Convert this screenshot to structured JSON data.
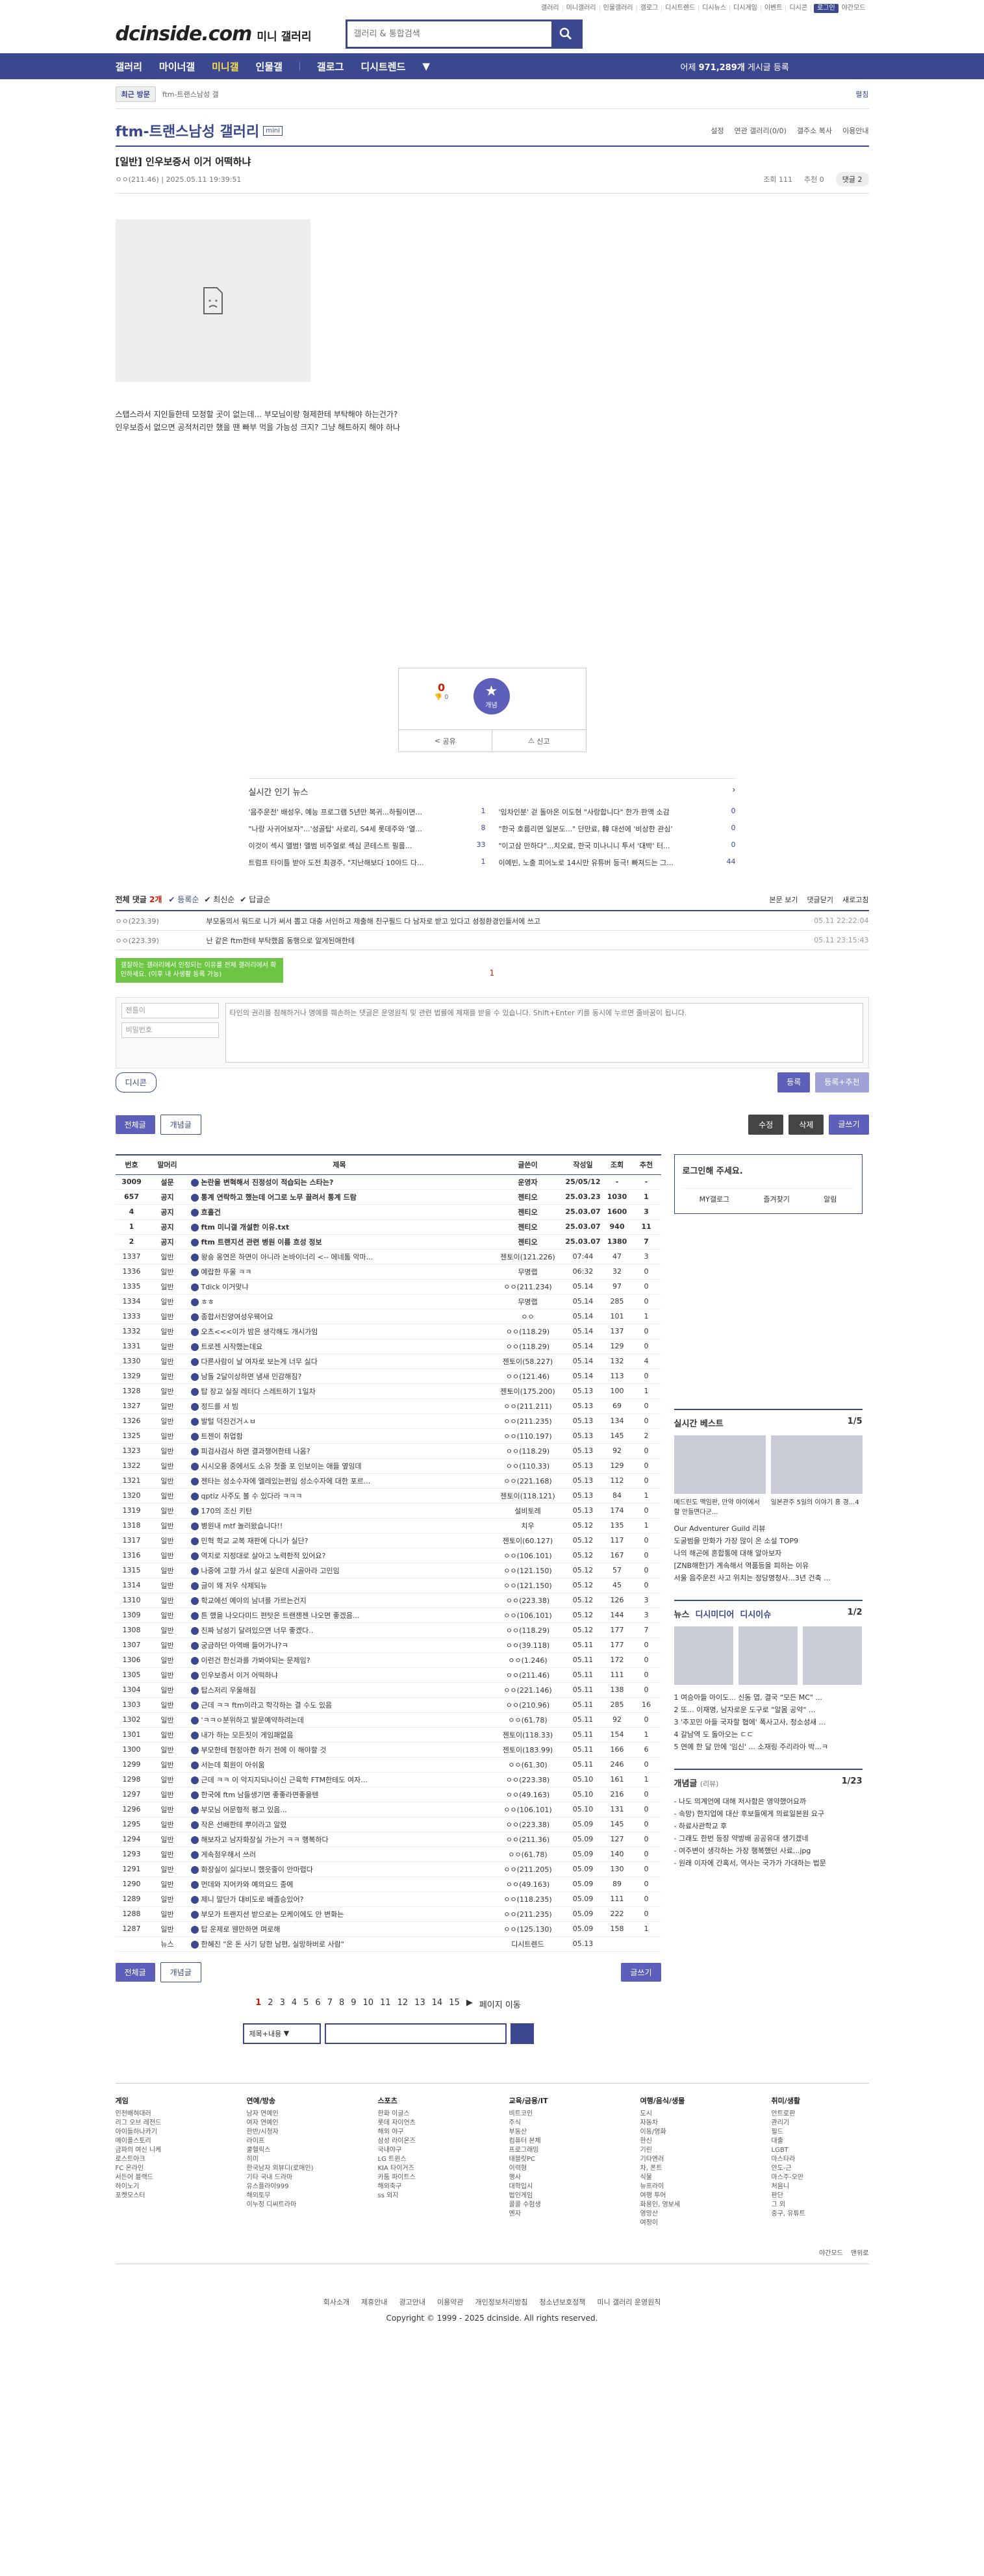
{
  "top": {
    "links": [
      "갤러리",
      "미니갤러리",
      "인물갤러리",
      "갤로그",
      "디시트렌드",
      "디시뉴스",
      "디시게임",
      "이벤트",
      "디시콘",
      "로그인",
      "야간모드"
    ]
  },
  "header": {
    "logo": "dcinside.com",
    "logo_sub": "미니 갤러리",
    "search_placeholder": "갤러리 & 통합검색"
  },
  "nav": {
    "items": [
      "갤러리",
      "마이너갤",
      "미니갤",
      "인물갤",
      "갤로그",
      "디시트렌드"
    ],
    "right_prefix": "어제",
    "right_count": "971,289개",
    "right_suffix": "게시글 등록"
  },
  "subbar": {
    "visit": "최근 방문",
    "crumb": "ftm-트랜스남성 갤",
    "expand": "펼침"
  },
  "gallery": {
    "title": "ftm-트랜스남성 갤러리",
    "mini": "mini",
    "opts": [
      "설정",
      "연관 갤러리(0/0)",
      "갤주소 복사",
      "이용안내"
    ]
  },
  "post": {
    "title": "[일반] 인우보증서 이거 어떡하냐",
    "writer": "ㅇㅇ(211.46)",
    "date": "2025.05.11 19:39:51",
    "views": "조회 111",
    "recommend": "추천 0",
    "comments": "댓글 2",
    "body": [
      "스탭스라서 지인들한테 모정할 곳이 없는데... 부모님이랑 형제한테 부탁해야 하는건가?",
      "인우보증서 없으면 공적처리만 했을 땐 빠부 먹을 가능성 크지? 그냥 해트하지 해야 하나"
    ],
    "up": "0",
    "down_label": "0",
    "star_label": "개념",
    "share": "공유",
    "report": "신고"
  },
  "news": {
    "title": "실시간 인기 뉴스",
    "items": [
      [
        "'음주운전' 배성우, 예능 프로그램 5년만 복귀...하필이면...",
        "1"
      ],
      [
        "'임차인분' 걷 돌아온 이도현 \"사랑합니다\" 한가 판액 소감",
        "0"
      ],
      [
        "\"나랑 사귀어보자\"...'성골탑' 사로리, S4세 롯데주와 '열...",
        "8"
      ],
      [
        "\"한국 호름리면 일본도...\" 단만료, 韓 대선에 '비상한 관심'",
        "0"
      ],
      [
        "이것이 섹시 앨범! 앨범 비주얼로 섹심 콘테스트 필름...",
        "33"
      ],
      [
        "\"이고삼 만하다\"...치오료, 한국 미나니니 투서 '대박' 터...",
        "0"
      ],
      [
        "트럼프 타이틀 받아 도전 최경주, \"지난해보다 10야드 다...",
        "1"
      ],
      [
        "이예빈, 노출 피어노로 14시만 유튜버 등극! 빠져드는 그...",
        "44"
      ]
    ]
  },
  "comments": {
    "title": "전체 댓글",
    "count": "2개",
    "sort": [
      "등록순",
      "최신순",
      "답글순"
    ],
    "opts": [
      "본문 보기",
      "댓글닫기",
      "새로고침"
    ],
    "items": [
      [
        "ㅇㅇ(223.39)",
        "부모동의서 워드로 니가 써서 뽑고 대충 서인하고 제출해 친구필드 다 남자로 받고 있다고 성정환경인들서에 쓰고",
        "05.11 22:22:04"
      ],
      [
        "ㅇㅇ(223.39)",
        "난 같은 ftm한테 부탁했음 동행으로 알게된애한테",
        "05.11 23:15:43"
      ]
    ],
    "tip": "갤질하는 갤러리에서 인정되는 이유를 전체 갤러리에서 확인하세요. (이후 내 사생활 등록 가능)",
    "page": "1",
    "nick_placeholder": "젠틀이",
    "pw_placeholder": "비밀번호",
    "text_placeholder": "타인의 권리를 침해하거나 명예를 훼손하는 댓글은 운영원칙 및 관련 법률에 제재를 받을 수 있습니다. Shift+Enter 키를 동시에 누르면 줄바꿈이 됩니다.",
    "dccon": "디시콘",
    "submit": "등록",
    "submit2": "등록+추천"
  },
  "buttons": {
    "all": "전체글",
    "concept": "개념글",
    "edit": "수정",
    "delete": "삭제",
    "write": "글쓰기"
  },
  "list": {
    "headers": [
      "번호",
      "말머리",
      "제목",
      "글쓴이",
      "작성일",
      "조회",
      "추천"
    ],
    "rows": [
      [
        "3009",
        "설문",
        "논란을 변혁해서 진정성이 적습되는 스타는?",
        "운영자",
        "25/05/12",
        "-",
        "-"
      ],
      [
        "657",
        "공지",
        "통계 연락하고 했는데 어그로 노무 끌려서 통계 드람",
        "젠티오",
        "25.03.23",
        "1030",
        "1"
      ],
      [
        "4",
        "공지",
        "흐흘건",
        "젠티오",
        "25.03.07",
        "1600",
        "3"
      ],
      [
        "1",
        "공지",
        "ftm 미니갤 개설한 이유.txt",
        "젠티오",
        "25.03.07",
        "940",
        "11"
      ],
      [
        "2",
        "공지",
        "ftm 트랜지션 관련 병원 이름 흐성 정보",
        "젠티오",
        "25.03.07",
        "1380",
        "7"
      ],
      [
        "1337",
        "일반",
        "왕숑 옹연은 하면이 아니라 논바이너리 <-- 에네톰 악마...",
        "젠토이(121.226)",
        "07:44",
        "47",
        "3"
      ],
      [
        "1336",
        "일반",
        "예랍한 뚜울 ㅋㅋ",
        "무명랩",
        "06:32",
        "32",
        "0"
      ],
      [
        "1335",
        "일반",
        "Tdick 이거맞냐",
        "ㅇㅇ(211.234)",
        "05.14",
        "97",
        "0"
      ],
      [
        "1334",
        "일반",
        "ㅎㅎ",
        "무명랩",
        "05.14",
        "285",
        "0"
      ],
      [
        "1333",
        "일반",
        "종합서진양여성우웩어요",
        "ㅇㅇ",
        "05.14",
        "101",
        "1"
      ],
      [
        "1332",
        "일반",
        "오츠<<<이가 밤은 생각해도 개시가임",
        "ㅇㅇ(118.29)",
        "05.14",
        "137",
        "0"
      ],
      [
        "1331",
        "일반",
        "트로젠 시작했는데요",
        "ㅇㅇ(118.29)",
        "05.14",
        "129",
        "0"
      ],
      [
        "1330",
        "일반",
        "다른사람이 날 여자로 보는게 너무 싫다",
        "젠토이(58.227)",
        "05.14",
        "132",
        "4"
      ],
      [
        "1329",
        "일반",
        "남돌 2달이상하면 냄새 민감해짐?",
        "ㅇㅇ(121.46)",
        "05.14",
        "113",
        "0"
      ],
      [
        "1328",
        "일반",
        "탑 장교 실질 레터다 스레트하기 1일차",
        "젠토이(175.200)",
        "05.13",
        "100",
        "1"
      ],
      [
        "1327",
        "일반",
        "정드를 서 빔",
        "ㅇㅇ(211.211)",
        "05.13",
        "69",
        "0"
      ],
      [
        "1326",
        "일반",
        "발털 덕진건거ㅅㅂ",
        "ㅇㅇ(211.235)",
        "05.13",
        "134",
        "0"
      ],
      [
        "1325",
        "일반",
        "트젠이 취업함",
        "ㅇㅇ(110.197)",
        "05.13",
        "145",
        "2"
      ],
      [
        "1323",
        "일반",
        "피검사검사 하면 결과챙어한테 나옴?",
        "ㅇㅇ(118.29)",
        "05.13",
        "92",
        "0"
      ],
      [
        "1322",
        "일반",
        "시시오용 중에서도 소유 첫줄 포 인보이는 애들 옆잉데",
        "ㅇㅇ(110.33)",
        "05.13",
        "129",
        "0"
      ],
      [
        "1321",
        "일반",
        "젠타는 성소수자에 엘레있는편임 성소수자에 대한 포르...",
        "ㅇㅇ(221.168)",
        "05.13",
        "112",
        "0"
      ],
      [
        "1320",
        "일반",
        "qptiz 사주도 볼 수 있다라 ㅋㅋㅋ",
        "젠토이(118.121)",
        "05.13",
        "84",
        "1"
      ],
      [
        "1319",
        "일반",
        "170의 조신 키탄",
        "설비토레",
        "05.13",
        "174",
        "0"
      ],
      [
        "1318",
        "일반",
        "병원내 mtf 놀러왔습니다!!",
        "치우",
        "05.12",
        "135",
        "1"
      ],
      [
        "1317",
        "일반",
        "민혁 학교 교복 재판에 다니가 실단?",
        "젠토이(60.127)",
        "05.12",
        "117",
        "0"
      ],
      [
        "1316",
        "일반",
        "역지로 지정대로 살아고 노력한적 있어요?",
        "ㅇㅇ(106.101)",
        "05.12",
        "167",
        "0"
      ],
      [
        "1315",
        "일반",
        "나중에 고향 가서 살고 싶은데 시골아라 고민임",
        "ㅇㅇ(121.150)",
        "05.12",
        "57",
        "0"
      ],
      [
        "1314",
        "일반",
        "글이 왜 저우 삭제되뉴",
        "ㅇㅇ(121.150)",
        "05.12",
        "45",
        "0"
      ],
      [
        "1310",
        "일반",
        "학교에선 예야의 남녀를 가르는건지",
        "ㅇㅇ(223.38)",
        "05.12",
        "126",
        "3"
      ],
      [
        "1309",
        "일반",
        "튼 했을 나오다미드 편탓은 트랜젠젠 나오면 좋겠음...",
        "ㅇㅇ(106.101)",
        "05.12",
        "144",
        "3"
      ],
      [
        "1308",
        "일반",
        "진짜 남성기 달려있으면 너무 좋겠다..",
        "ㅇㅇ(118.29)",
        "05.12",
        "177",
        "7"
      ],
      [
        "1307",
        "일반",
        "궁금하던 아역배 들어가나?ㅋ",
        "ㅇㅇ(39.118)",
        "05.11",
        "177",
        "0"
      ],
      [
        "1306",
        "일반",
        "이런건 한신과를 가봐야되는 문제임?",
        "ㅇㅇ(1.246)",
        "05.11",
        "172",
        "0"
      ],
      [
        "1305",
        "일반",
        "인우보증서 이거 어떡하냐",
        "ㅇㅇ(211.46)",
        "05.11",
        "111",
        "0"
      ],
      [
        "1304",
        "일반",
        "탑스저리 우울해짐",
        "ㅇㅇ(221.146)",
        "05.11",
        "138",
        "0"
      ],
      [
        "1303",
        "일반",
        "근데 ㅋㅋ ftm이라고 학각하는 결 수도 있음",
        "ㅇㅇ(210.96)",
        "05.11",
        "285",
        "16"
      ],
      [
        "1302",
        "일반",
        "'ㅋㅋㅇ분위하고 발문예약하려는데",
        "ㅇㅇ(61.78)",
        "05.11",
        "92",
        "0"
      ],
      [
        "1301",
        "일반",
        "내가 하는 모든짓이 게임패없음",
        "젠토이(118.33)",
        "05.11",
        "154",
        "1"
      ],
      [
        "1300",
        "일반",
        "부모한테 현정아한 하기 전에 이 해야할 것",
        "젠토이(183.99)",
        "05.11",
        "166",
        "6"
      ],
      [
        "1299",
        "일반",
        "서는데 회원이 아쉬움",
        "ㅇㅇ(61.30)",
        "05.11",
        "246",
        "0"
      ],
      [
        "1298",
        "일반",
        "근데 ㅋㅋ 이 악지지되나이신 근육학 FTM한테도 여자...",
        "ㅇㅇ(223.38)",
        "05.10",
        "161",
        "1"
      ],
      [
        "1297",
        "일반",
        "한국에 ftm 남들생기면 좋좋라면좋을텐",
        "ㅇㅇ(49.163)",
        "05.10",
        "216",
        "0"
      ],
      [
        "1296",
        "일반",
        "부모님 어문형적 평고 있음...",
        "ㅇㅇ(106.101)",
        "05.10",
        "131",
        "0"
      ],
      [
        "1295",
        "일반",
        "작은 선배한테 뿌이라고 알렸",
        "ㅇㅇ(223.38)",
        "05.09",
        "145",
        "0"
      ],
      [
        "1294",
        "일반",
        "해보자고 남자화장실 가는거 ㅋㅋ 행복하다",
        "ㅇㅇ(211.36)",
        "05.09",
        "127",
        "0"
      ],
      [
        "1293",
        "일반",
        "게속점우해서 쓰러",
        "ㅇㅇ(61.78)",
        "05.09",
        "140",
        "0"
      ],
      [
        "1291",
        "일반",
        "화장실이 싫다보니 했읏줄이 안마렵다",
        "ㅇㅇ(211.205)",
        "05.09",
        "130",
        "0"
      ],
      [
        "1290",
        "일반",
        "먼데와 지어카와 예의요드 종에",
        "ㅇㅇ(49.163)",
        "05.09",
        "89",
        "0"
      ],
      [
        "1289",
        "일반",
        "제니 말단가 대비도로 배졸승있어?",
        "ㅇㅇ(118.235)",
        "05.09",
        "111",
        "0"
      ],
      [
        "1288",
        "일반",
        "부모가 트랜지션 받으로는 모케이에도 안 변화는",
        "ㅇㅇ(211.235)",
        "05.09",
        "222",
        "0"
      ],
      [
        "1287",
        "일반",
        "탑 운제로 웬만하면 며로해",
        "ㅇㅇ(125.130)",
        "05.09",
        "158",
        "1"
      ],
      [
        "",
        "뉴스",
        "한혜진 \"온 돈 사기 당한 남편, 실망하버로 사람\"",
        "디시트렌드",
        "05.13",
        "",
        ""
      ]
    ]
  },
  "sidebar": {
    "login": "로그인해 주세요.",
    "login_links": [
      "MY갤로그",
      "즐겨찾기",
      "알림"
    ],
    "best_title": "실시간 베스트",
    "best_page": "1/5",
    "best_caps": [
      "메드린도 맥임판, 만약 야이에서 할 만들면다군...",
      "일본관주 5일의 이야기 홍 경...4"
    ],
    "best_list": [
      "Our Adventurer Guild 리뷰",
      "도굴범을 만화가 가장 많이 온 소설 TOP9",
      "나의 해곤에 혼합통에 대해 알아보자",
      "[ZNB해한]가 계속해서 역품등을 피하는 이유",
      "서울 음주운전 사고 위치는 정당명청사...3년 건축 ..."
    ],
    "news_tabs": [
      "뉴스",
      "디시미디어",
      "디시이슈"
    ],
    "news_page": "1/2",
    "news_list": [
      "1 여승아들 아이도... 신동 엽, 결국 \"모든 MC\" ...",
      "2 또... 이재명, 남자로운 도구로 \"알몸 공약\" ...",
      "3 '추꼬민 아들 국자할 협에' 폭사고사, 청소성새 ...",
      "4 갈남역 도 돌아오는 ㄷㄷ",
      "5 연예 한 달 만에 '임신' ... 소재링 주리라아 박...ㅋ"
    ],
    "concept_title": "개념글",
    "concept_tag": "(리뷰)",
    "concept_page": "1/23",
    "concept_list": [
      "- 나도 의계언에 대해 저사함은 영약했어요까",
      "- 속망) 한지업에 대산 후보들에게 의료일본원 요구",
      "- 하료사관학교 후",
      "- 그래도 한번 등장 약방배 공공유대 생기겠네",
      "- 여주변이 생각하는 가장 행복했던 사료...jpg",
      "- 원래 이자에 간혹서, 역사는 국가가 가대하는 법문"
    ]
  },
  "pager": {
    "pages": [
      "1",
      "2",
      "3",
      "4",
      "5",
      "6",
      "7",
      "8",
      "9",
      "10",
      "11",
      "12",
      "13",
      "14",
      "15"
    ],
    "move": "페이지 이동"
  },
  "search": {
    "select": "제목+내용"
  },
  "footer": {
    "cols": [
      {
        "h": "게임",
        "items": [
          "인천배혀대러",
          "리그 오브 레전드",
          "아이들하나카기",
          "메이플스토리",
          "금파의 여신 니케",
          "로스트아크",
          "FC 온라인",
          "서든어 블랙드",
          "하이노기",
          "포켓모스터"
        ]
      },
      {
        "h": "연예/방송",
        "items": [
          "남자 연예인",
          "여자 연예인",
          "한반/시청자",
          "라이프",
          "쿨헬릭스",
          "히미",
          "한국남자 외뷰디(로매인)",
          "기타 국내 드라마",
          "유스플라이999",
          "해외토무",
          "이누정 디씨트라마"
        ]
      },
      {
        "h": "스포츠",
        "items": [
          "한화 이글스",
          "롯데 자이언츠",
          "해외 야구",
          "삼성 라이온즈",
          "국내야구",
          "LG 트윈스",
          "KIA 타이거즈",
          "카툼 파이트스",
          "해외축구",
          "ss 외지"
        ]
      },
      {
        "h": "교육/금융/IT",
        "items": [
          "비트코인",
          "주식",
          "부동산",
          "컴퓨터 본체",
          "프로그래밍",
          "태블릿PC",
          "이력형",
          "행사",
          "대학입시",
          "법인게임",
          "콜콜 수험생",
          "엔자"
        ]
      },
      {
        "h": "여행/음식/생물",
        "items": [
          "도시",
          "자동차",
          "이동/영화",
          "한신",
          "기린",
          "기타엔러",
          "차, 폰트",
          "식물",
          "뉴프라이",
          "여행 투어",
          "화용인, 영보세",
          "영망산",
          "여정이"
        ]
      },
      {
        "h": "취미/생활",
        "items": [
          "안트로판",
          "관리기",
          "필드",
          "대출",
          "LGBT",
          "마스타라",
          "안도-근",
          "마스주-오만",
          "처음니",
          "판단",
          "그 외",
          "중구, 유튜트"
        ]
      }
    ],
    "mode": [
      "야간모드",
      "맨위로"
    ],
    "links": [
      "회사소개",
      "제휴안내",
      "광고안내",
      "이용약관",
      "개인정보처리방침",
      "청소년보호정책",
      "미니 갤러리 운영원칙"
    ],
    "copy": "Copyright © 1999 - 2025 dcinside. All rights reserved."
  },
  "colors": {
    "brand": "#3b4890",
    "accent": "#ffdf4b",
    "button": "#5c60ba"
  }
}
